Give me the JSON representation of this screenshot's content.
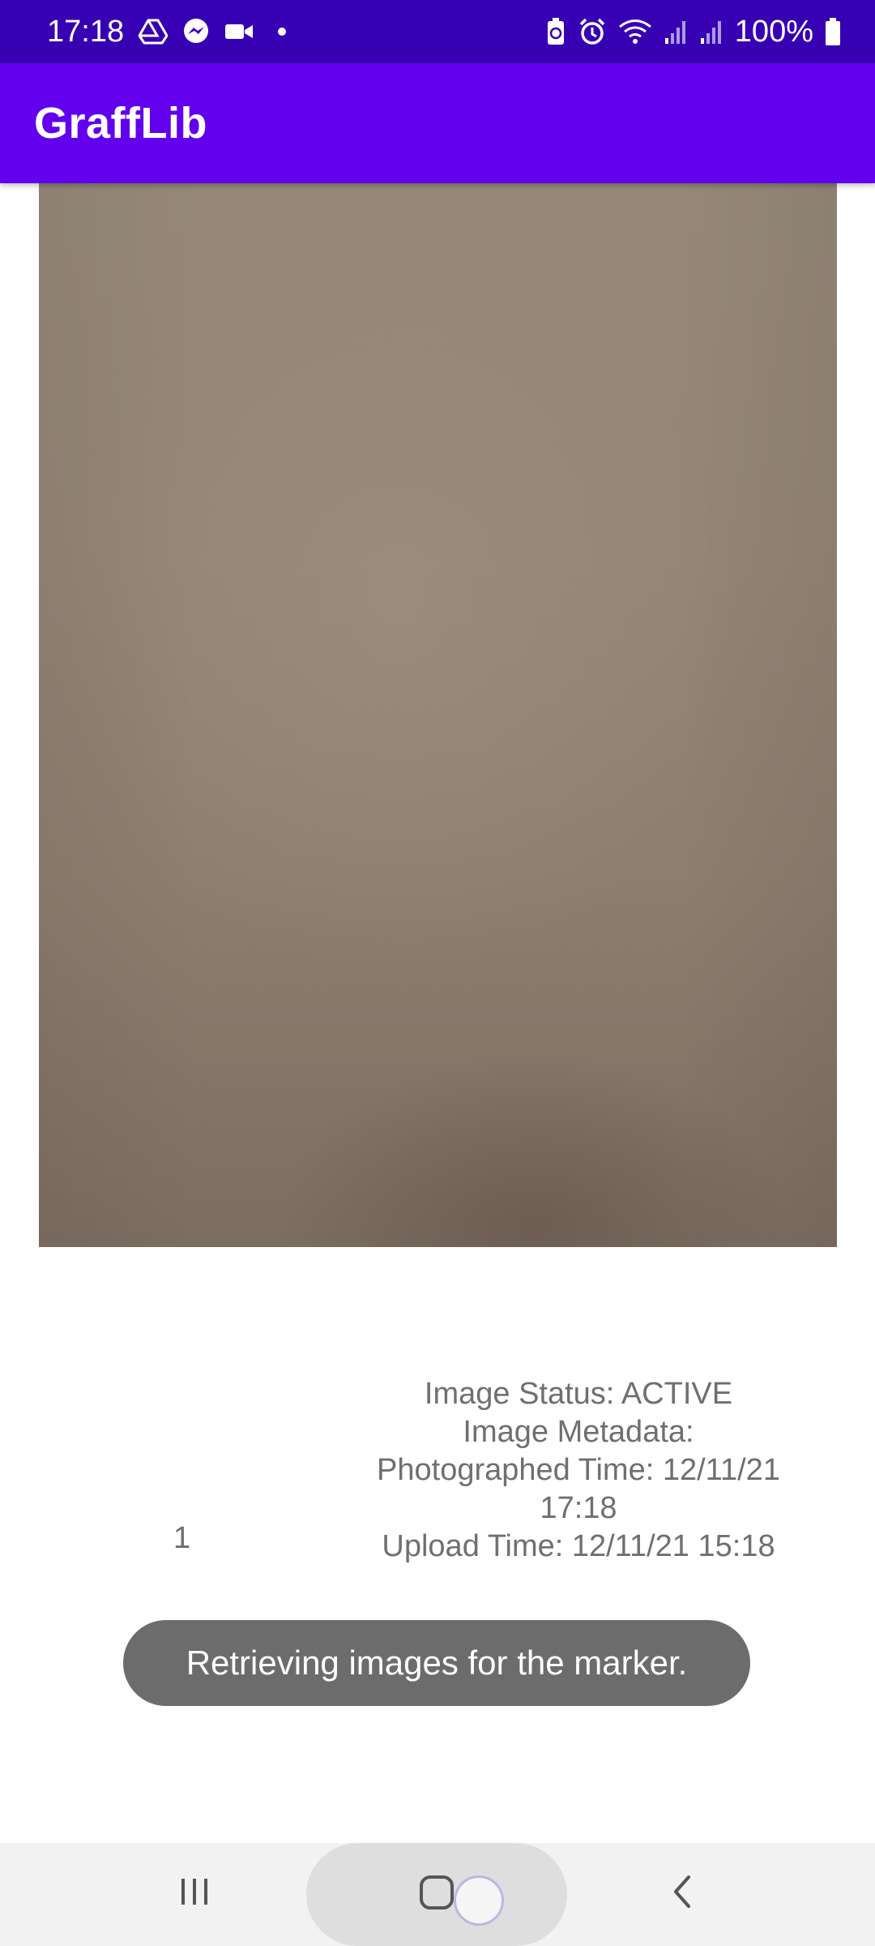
{
  "status_bar": {
    "time": "17:18",
    "battery_text": "100%",
    "left_icons": [
      "drive-icon",
      "messenger-icon",
      "video-camera-icon",
      "notification-dot-icon"
    ],
    "right_icons": [
      "battery-saver-icon",
      "alarm-icon",
      "wifi-icon",
      "signal-icon",
      "signal-icon",
      "battery-icon"
    ]
  },
  "app_bar": {
    "title": "GraffLib"
  },
  "image_view": {
    "description_colors": [
      "#958878",
      "#7c6d61"
    ]
  },
  "image_info": {
    "index": "1",
    "status_line": "Image Status: ACTIVE",
    "metadata_heading": "Image Metadata:",
    "photographed_line_1": "Photographed Time: 12/11/21",
    "photographed_line_2": "17:18",
    "upload_line": "Upload Time: 12/11/21 15:18"
  },
  "toast": {
    "message": "Retrieving images for the marker."
  },
  "nav_bar": {
    "recent_icon": "recent-apps-icon",
    "home_icon": "home-icon",
    "back_icon": "back-icon"
  },
  "colors": {
    "status_bar": "#3700b3",
    "app_bar": "#6200ee",
    "toast": "#6c6c6c",
    "text_secondary": "#6f6f6f"
  }
}
